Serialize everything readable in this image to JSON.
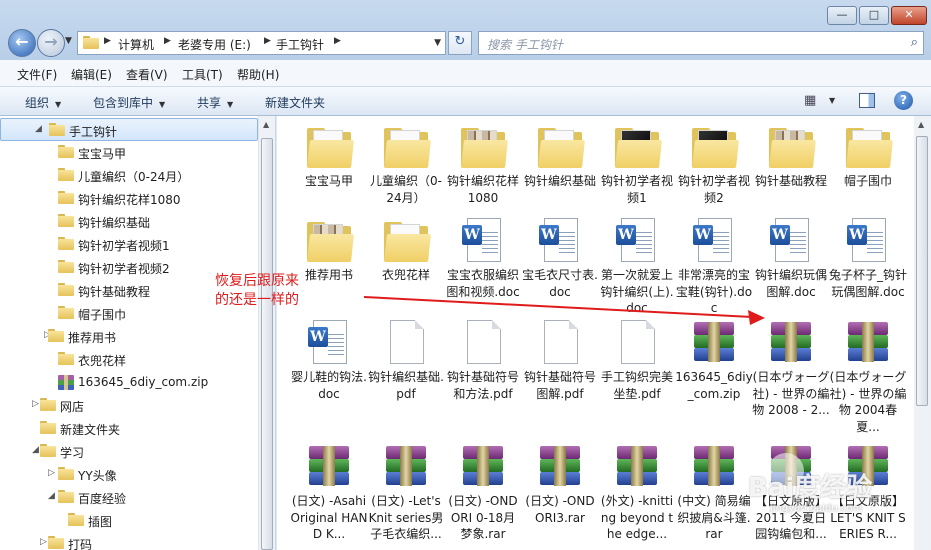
{
  "window": {
    "minimize": "—",
    "maximize": "□",
    "close": "✕"
  },
  "nav": {
    "back": "←",
    "forward": "→",
    "history": "▼"
  },
  "address": {
    "crumbs": [
      "计算机",
      "老婆专用 (E:)",
      "手工钩针"
    ],
    "separator": "▶",
    "dropdown": "▼",
    "refresh": "↻"
  },
  "search": {
    "placeholder": "搜索 手工钩针",
    "icon": "⌕"
  },
  "menu": [
    "文件(F)",
    "编辑(E)",
    "查看(V)",
    "工具(T)",
    "帮助(H)"
  ],
  "toolbar": {
    "organize": "组织",
    "include_library": "包含到库中",
    "share": "共享",
    "new_folder": "新建文件夹",
    "dropdown_glyph": "▼",
    "view_glyph": "▦",
    "help": "?"
  },
  "sidebar": {
    "items": [
      {
        "label": "手工钩针",
        "icon": "folder",
        "expander": "◢",
        "selected": true
      },
      {
        "label": "宝宝马甲",
        "icon": "folder",
        "expander": ""
      },
      {
        "label": "儿童编织（0-24月）",
        "icon": "folder",
        "expander": ""
      },
      {
        "label": "钩针编织花样1080",
        "icon": "folder",
        "expander": ""
      },
      {
        "label": "钩针编织基础",
        "icon": "folder",
        "expander": ""
      },
      {
        "label": "钩针初学者视频1",
        "icon": "folder",
        "expander": ""
      },
      {
        "label": "钩针初学者视频2",
        "icon": "folder",
        "expander": ""
      },
      {
        "label": "钩针基础教程",
        "icon": "folder",
        "expander": ""
      },
      {
        "label": "帽子围巾",
        "icon": "folder",
        "expander": ""
      },
      {
        "label": "推荐用书",
        "icon": "folder",
        "expander": "▷"
      },
      {
        "label": "衣兜花样",
        "icon": "folder",
        "expander": ""
      },
      {
        "label": "163645_6diy_com.zip",
        "icon": "rar",
        "expander": ""
      },
      {
        "label": "网店",
        "icon": "folder",
        "expander": "▷"
      },
      {
        "label": "新建文件夹",
        "icon": "folder",
        "expander": ""
      },
      {
        "label": "学习",
        "icon": "folder",
        "expander": "◢"
      },
      {
        "label": "YY头像",
        "icon": "folder",
        "expander": "▷"
      },
      {
        "label": "百度经验",
        "icon": "folder",
        "expander": "◢"
      },
      {
        "label": "插图",
        "icon": "folder",
        "expander": ""
      },
      {
        "label": "打码",
        "icon": "folder",
        "expander": "▷"
      }
    ]
  },
  "files": [
    {
      "name": "宝宝马甲",
      "type": "folder",
      "variant": "plain"
    },
    {
      "name": "儿童编织（0-24月）",
      "type": "folder",
      "variant": "plain"
    },
    {
      "name": "钩针编织花样1080",
      "type": "folder",
      "variant": "pics"
    },
    {
      "name": "钩针编织基础",
      "type": "folder",
      "variant": "plain"
    },
    {
      "name": "钩针初学者视频1",
      "type": "folder",
      "variant": "dark"
    },
    {
      "name": "钩针初学者视频2",
      "type": "folder",
      "variant": "dark"
    },
    {
      "name": "钩针基础教程",
      "type": "folder",
      "variant": "pics"
    },
    {
      "name": "帽子围巾",
      "type": "folder",
      "variant": "plain"
    },
    {
      "name": "推荐用书",
      "type": "folder",
      "variant": "pics"
    },
    {
      "name": "衣兜花样",
      "type": "folder",
      "variant": "plain"
    },
    {
      "name": "宝宝衣服编织图和视频.doc",
      "type": "doc"
    },
    {
      "name": "宝毛衣尺寸表.doc",
      "type": "doc"
    },
    {
      "name": "第一次就爱上钩针编织(上).doc",
      "type": "doc"
    },
    {
      "name": "非常漂亮的宝宝鞋(钩针).doc",
      "type": "doc"
    },
    {
      "name": "钩针编织玩偶图解.doc",
      "type": "doc"
    },
    {
      "name": "兔子杯子_钩针玩偶图解.doc",
      "type": "doc"
    },
    {
      "name": "婴儿鞋的钩法.doc",
      "type": "doc"
    },
    {
      "name": "钩针编织基础.pdf",
      "type": "pdf"
    },
    {
      "name": "钩针基础符号和方法.pdf",
      "type": "pdf"
    },
    {
      "name": "钩针基础符号图解.pdf",
      "type": "pdf"
    },
    {
      "name": "手工钩织完美坐垫.pdf",
      "type": "pdf"
    },
    {
      "name": "163645_6diy_com.zip",
      "type": "rar"
    },
    {
      "name": "(日本ヴォーグ社) - 世界の編物 2008 - 2...",
      "type": "rar"
    },
    {
      "name": "(日本ヴォーグ社) - 世界の編物 2004春夏...",
      "type": "rar"
    },
    {
      "name": "(日文) -Asahi Original HAND K...",
      "type": "rar"
    },
    {
      "name": "(日文) -Let's Knit series男子毛衣编织...",
      "type": "rar"
    },
    {
      "name": "(日文) -ONDORI 0-18月 梦象.rar",
      "type": "rar"
    },
    {
      "name": "(日文) -ONDORI3.rar",
      "type": "rar"
    },
    {
      "name": "(外文) -knitting beyond the edge...",
      "type": "rar"
    },
    {
      "name": "(中文) 简易编织披肩&斗篷.rar",
      "type": "rar"
    },
    {
      "name": "【日文原版】 2011 今夏日园钩编包和...",
      "type": "rar"
    },
    {
      "name": "【日文原版】LET'S KNIT SERIES R...",
      "type": "rar"
    }
  ],
  "annotation": {
    "line1": "恢复后跟原来",
    "line2": "的还是一样的",
    "color": "#e01b1b"
  },
  "watermark": {
    "text": "Bai​度经验",
    "sub": "jingyan.baidu.com"
  }
}
